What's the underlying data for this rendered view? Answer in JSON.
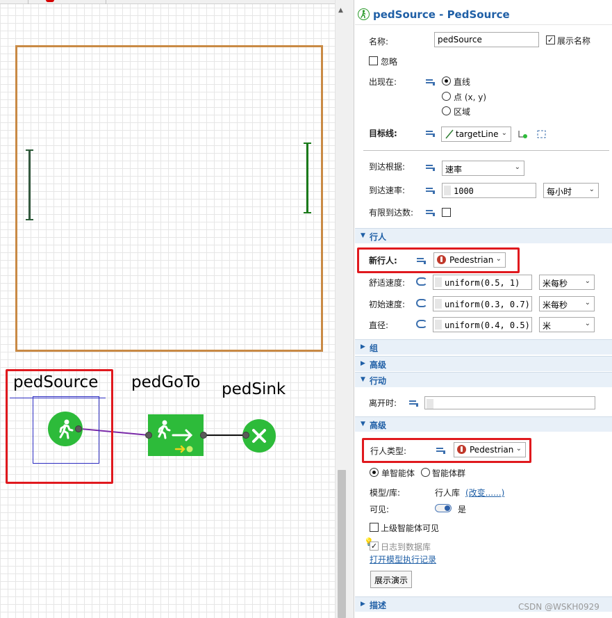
{
  "canvas": {
    "blocks": {
      "source": "pedSource",
      "goto": "pedGoTo",
      "sink": "pedSink"
    }
  },
  "panel": {
    "title": "pedSource - PedSource",
    "name_label": "名称:",
    "name_value": "pedSource",
    "show_name_label": "展示名称",
    "show_name_checked": true,
    "ignore_label": "忽略",
    "ignore_checked": false,
    "appear_label": "出现在:",
    "appear_options": [
      "直线",
      "点 (x, y)",
      "区域"
    ],
    "appear_selected": "直线",
    "target_line_label": "目标线:",
    "target_line_value": "targetLine",
    "arrivals_label": "到达根据:",
    "arrivals_value": "速率",
    "rate_label": "到达速率:",
    "rate_value": "1000",
    "rate_unit": "每小时",
    "limited_label": "有限到达数:",
    "limited_checked": false,
    "sections": {
      "pedestrian": "行人",
      "group": "组",
      "advanced": "高级",
      "action": "行动",
      "advanced2": "高级",
      "description": "描述"
    },
    "new_ped_label": "新行人:",
    "new_ped_value": "Pedestrian",
    "comfort_speed_label": "舒适速度:",
    "comfort_speed_value": "uniform(0.5, 1)",
    "comfort_speed_unit": "米每秒",
    "initial_speed_label": "初始速度:",
    "initial_speed_value": "uniform(0.3, 0.7)",
    "initial_speed_unit": "米每秒",
    "diameter_label": "直径:",
    "diameter_value": "uniform(0.4, 0.5)",
    "diameter_unit": "米",
    "on_exit_label": "离开时:",
    "ped_type_label": "行人类型:",
    "ped_type_value": "Pedestrian",
    "agent_options": [
      "单智能体",
      "智能体群"
    ],
    "agent_selected": "单智能体",
    "model_label": "模型/库:",
    "model_value": "行人库",
    "model_change_link": "(改变......)",
    "visible_label": "可见:",
    "visible_value": "是",
    "upper_visible_label": "上级智能体可见",
    "log_label": "日志到数据库",
    "open_log_link": "打开模型执行记录",
    "demo_button": "展示演示"
  },
  "watermark": "CSDN @WSKH0929",
  "colors": {
    "accent_blue": "#1f5fa6",
    "highlight_red": "#e0191e",
    "block_green": "#2dbb3a",
    "area_orange": "#c98a45"
  }
}
